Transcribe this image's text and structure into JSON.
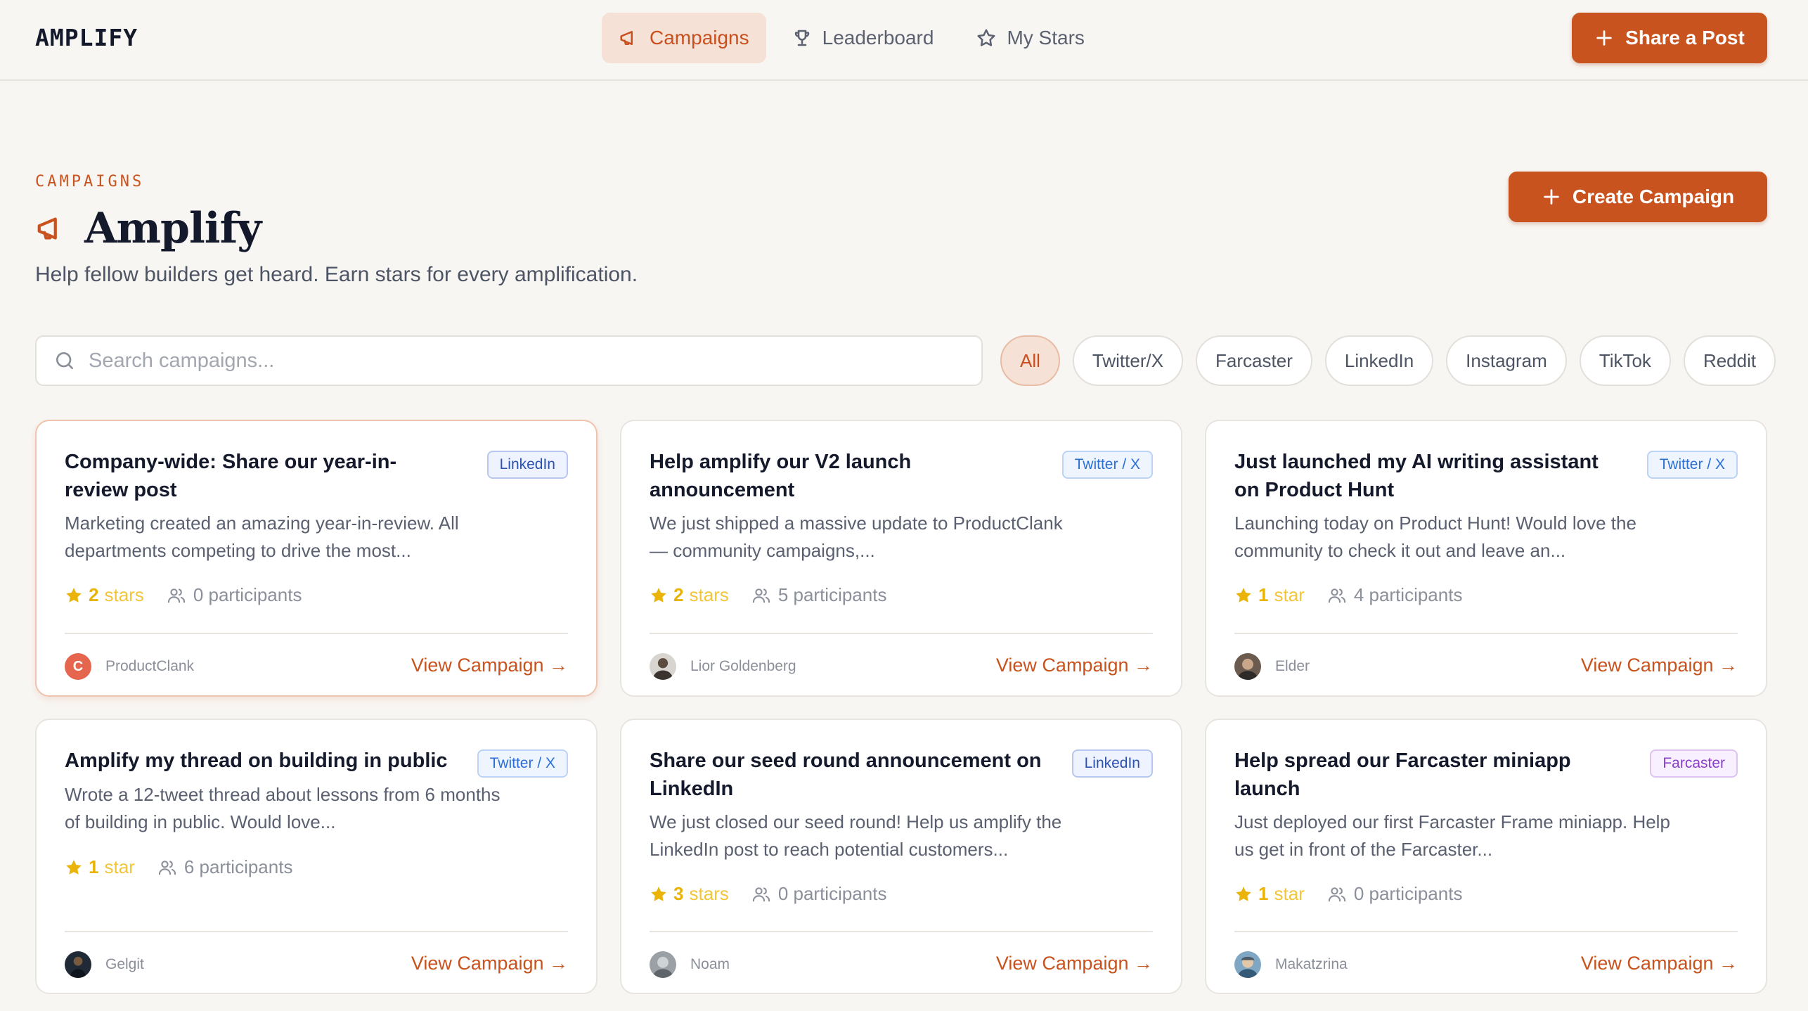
{
  "app": {
    "brand": "AMPLIFY"
  },
  "nav": {
    "items": [
      {
        "label": "Campaigns",
        "icon": "megaphone-icon",
        "active": true
      },
      {
        "label": "Leaderboard",
        "icon": "trophy-icon",
        "active": false
      },
      {
        "label": "My Stars",
        "icon": "star-icon",
        "active": false
      }
    ],
    "share_label": "Share a Post"
  },
  "header": {
    "eyebrow": "CAMPAIGNS",
    "title": "Amplify",
    "subtitle": "Help fellow builders get heard. Earn stars for every amplification.",
    "create_label": "Create Campaign"
  },
  "search": {
    "placeholder": "Search campaigns...",
    "value": ""
  },
  "filters": [
    {
      "label": "All",
      "active": true
    },
    {
      "label": "Twitter/X",
      "active": false
    },
    {
      "label": "Farcaster",
      "active": false
    },
    {
      "label": "LinkedIn",
      "active": false
    },
    {
      "label": "Instagram",
      "active": false
    },
    {
      "label": "TikTok",
      "active": false
    },
    {
      "label": "Reddit",
      "active": false
    }
  ],
  "colors": {
    "accent": "#c9531e",
    "accent_soft": "#f5e1d6",
    "star": "#eab308",
    "background": "#f8f6f3"
  },
  "cards": [
    {
      "title": "Company-wide: Share our year-in-review post",
      "platform": "LinkedIn",
      "description": "Marketing created an amazing year-in-review. All departments competing to drive the most...",
      "stars_count": "2",
      "stars_word": "stars",
      "participants": "0 participants",
      "author": "ProductClank",
      "avatar_letter": "C",
      "view_label": "View Campaign →"
    },
    {
      "title": "Help amplify our V2 launch announcement",
      "platform": "Twitter / X",
      "description": "We just shipped a massive update to ProductClank — community campaigns,...",
      "stars_count": "2",
      "stars_word": "stars",
      "participants": "5 participants",
      "author": "Lior Goldenberg",
      "view_label": "View Campaign →"
    },
    {
      "title": "Just launched my AI writing assistant on Product Hunt",
      "platform": "Twitter / X",
      "description": "Launching today on Product Hunt! Would love the community to check it out and leave an...",
      "stars_count": "1",
      "stars_word": "star",
      "participants": "4 participants",
      "author": "Elder",
      "view_label": "View Campaign →"
    },
    {
      "title": "Amplify my thread on building in public",
      "platform": "Twitter / X",
      "description": "Wrote a 12-tweet thread about lessons from 6 months of building in public. Would love...",
      "stars_count": "1",
      "stars_word": "star",
      "participants": "6 participants",
      "author": "Gelgit",
      "view_label": "View Campaign →"
    },
    {
      "title": "Share our seed round announcement on LinkedIn",
      "platform": "LinkedIn",
      "description": "We just closed our seed round! Help us amplify the LinkedIn post to reach potential customers...",
      "stars_count": "3",
      "stars_word": "stars",
      "participants": "0 participants",
      "author": "Noam",
      "view_label": "View Campaign →"
    },
    {
      "title": "Help spread our Farcaster miniapp launch",
      "platform": "Farcaster",
      "description": "Just deployed our first Farcaster Frame miniapp. Help us get in front of the Farcaster...",
      "stars_count": "1",
      "stars_word": "star",
      "participants": "0 participants",
      "author": "Makatzrina",
      "view_label": "View Campaign →"
    }
  ]
}
